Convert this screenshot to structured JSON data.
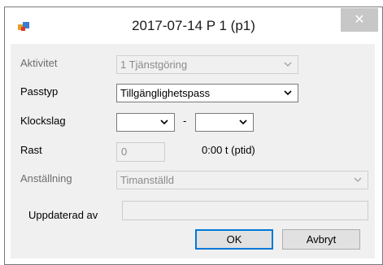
{
  "window": {
    "title": "2017-07-14 P 1 (p1)",
    "close_label": "✕"
  },
  "form": {
    "aktivitet": {
      "label": "Aktivitet",
      "value": "1 Tjänstgöring"
    },
    "passtyp": {
      "label": "Passtyp",
      "value": "Tillgänglighetspass"
    },
    "klockslag": {
      "label": "Klockslag",
      "from_value": "",
      "separator": "-",
      "to_value": ""
    },
    "rast": {
      "label": "Rast",
      "value": "0",
      "ptid_text": "0:00 t (ptid)"
    },
    "anstallning": {
      "label": "Anställning",
      "value": "Timanställd"
    },
    "uppdaterad_av": {
      "label": "Uppdaterad av",
      "value": ""
    }
  },
  "buttons": {
    "ok_label": "OK",
    "cancel_label": "Avbryt"
  },
  "colors": {
    "accent": "#0078d7",
    "close_button": "#c7c7c7",
    "client_background": "#f0f0f0"
  }
}
